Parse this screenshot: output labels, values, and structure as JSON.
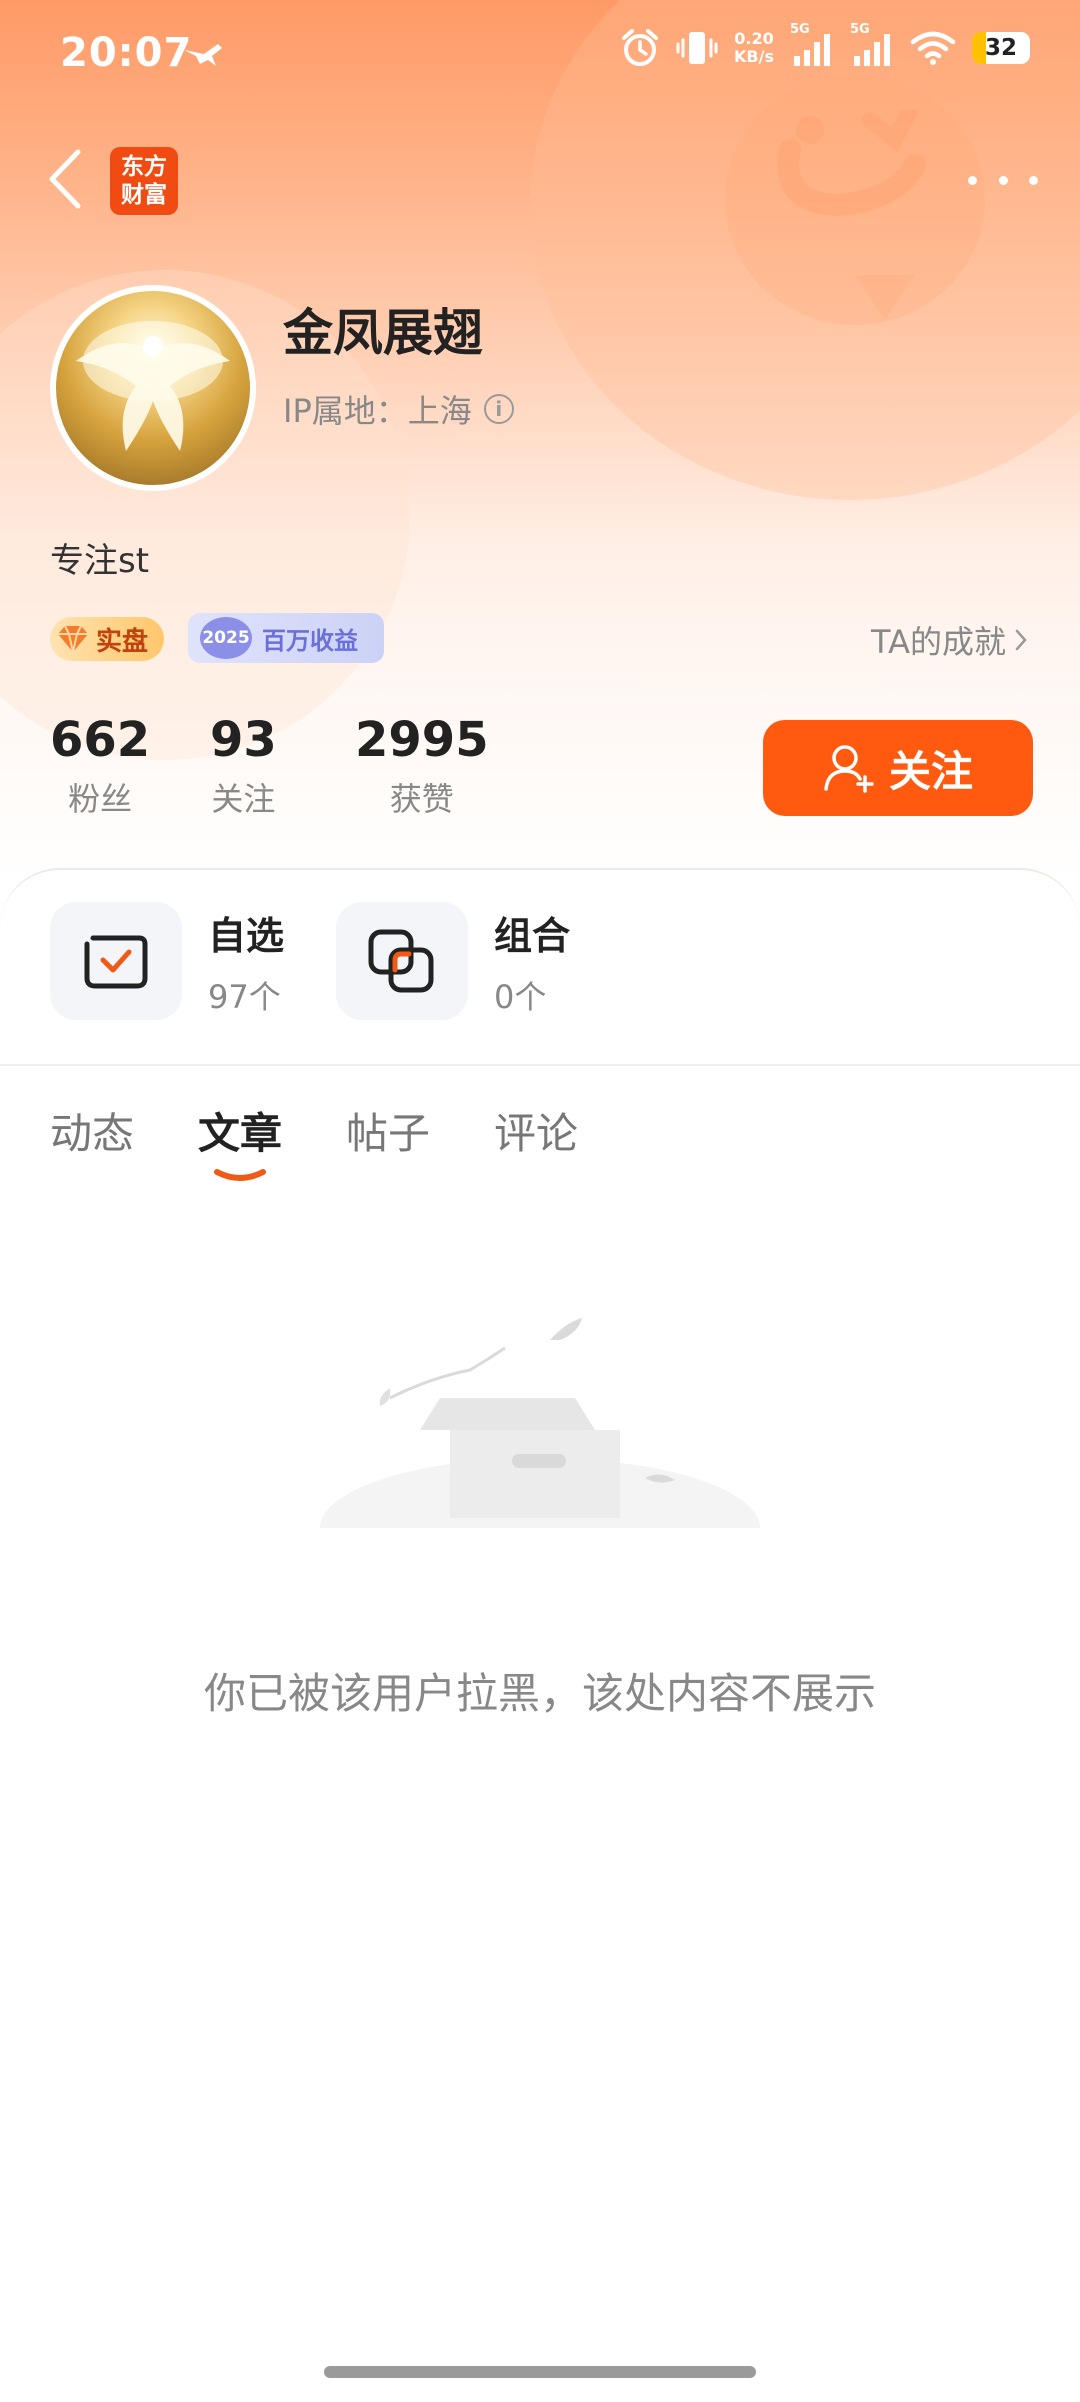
{
  "status_bar": {
    "time": "20:07",
    "net_speed_value": "0.20",
    "net_speed_unit": "KB/s",
    "signal_1_label": "5G",
    "signal_2_label": "5G",
    "battery": "32",
    "icons": [
      "bird-icon",
      "alarm-icon",
      "vibrate-icon",
      "signal-icon",
      "wifi-icon",
      "battery-icon"
    ]
  },
  "nav": {
    "logo_line1": "东方",
    "logo_line2": "财富"
  },
  "profile": {
    "username": "金凤展翅",
    "ip_location": "IP属地：上海",
    "bio": "专注st",
    "badges": {
      "shipan": "实盘",
      "year": "2025",
      "income": "百万收益"
    },
    "achievements_link": "TA的成就"
  },
  "stats": [
    {
      "value": "662",
      "label": "粉丝"
    },
    {
      "value": "93",
      "label": "关注"
    },
    {
      "value": "2995",
      "label": "获赞"
    }
  ],
  "follow_button": "关注",
  "features": [
    {
      "title": "自选",
      "count": "97个"
    },
    {
      "title": "组合",
      "count": "0个"
    }
  ],
  "tabs": [
    {
      "label": "动态",
      "active": false
    },
    {
      "label": "文章",
      "active": true
    },
    {
      "label": "帖子",
      "active": false
    },
    {
      "label": "评论",
      "active": false
    }
  ],
  "empty_state": {
    "message": "你已被该用户拉黑，该处内容不展示"
  },
  "colors": {
    "accent": "#ff5a0f",
    "header_gradient_top": "#ff9a66",
    "text_primary": "#222222",
    "text_secondary": "#888888"
  }
}
